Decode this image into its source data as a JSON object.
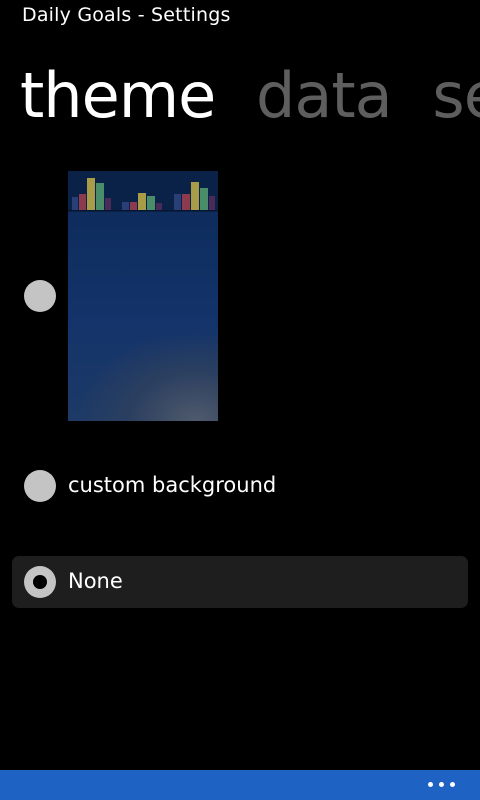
{
  "app": {
    "title": "Daily Goals - Settings"
  },
  "pivot": {
    "items": [
      {
        "label": "theme",
        "active": true
      },
      {
        "label": "data",
        "active": false
      },
      {
        "label": "sec",
        "active": false
      }
    ]
  },
  "theme_options": [
    {
      "type": "image-preview",
      "selected": false,
      "preview_icon": "bar-chart-theme-preview"
    },
    {
      "label": "custom background",
      "selected": false
    },
    {
      "label": "None",
      "selected": true
    }
  ],
  "app_bar": {
    "icon": "ellipsis-more-icon"
  },
  "colors": {
    "background": "#000000",
    "accent": "#1e63c4",
    "inactive_pivot": "#5e5e5e",
    "radio": "#c4c4c4",
    "selected_row": "#1e1e1e"
  }
}
